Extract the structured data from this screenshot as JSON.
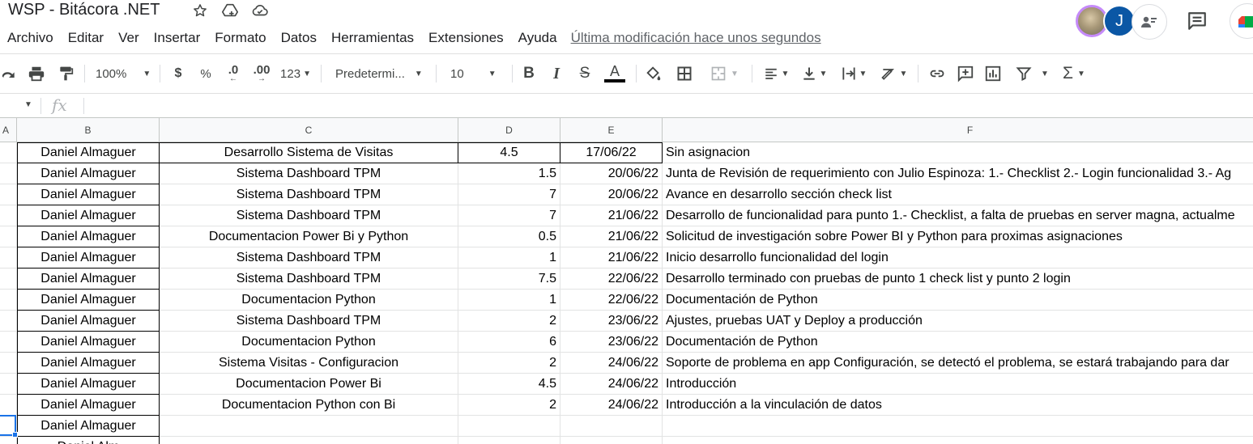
{
  "title": {
    "doc_name": "WSP - Bitácora .NET",
    "star_icon": "star-icon",
    "move_icon": "move-to-drive-icon",
    "cloud_icon": "cloud-saved-icon"
  },
  "menu": {
    "items": [
      "Archivo",
      "Editar",
      "Ver",
      "Insertar",
      "Formato",
      "Datos",
      "Herramientas",
      "Extensiones",
      "Ayuda"
    ],
    "last_modified": "Última modificación hace unos segundos"
  },
  "collaborators": {
    "second_initial": "J"
  },
  "toolbar": {
    "zoom": "100%",
    "currency": "$",
    "percent": "%",
    "decrease_decimals": ".0",
    "increase_decimals": ".00",
    "number_format": "123",
    "font_family": "Predetermi...",
    "font_size": "10"
  },
  "formula_bar": {
    "fx": "fx",
    "value": ""
  },
  "columns": [
    "A",
    "B",
    "C",
    "D",
    "E",
    "F"
  ],
  "rows": [
    {
      "b": "Daniel Almaguer",
      "c": "Desarrollo Sistema de Visitas",
      "d": "4.5",
      "e": "17/06/22",
      "f": "Sin asignacion"
    },
    {
      "b": "Daniel Almaguer",
      "c": "Sistema Dashboard TPM",
      "d": "1.5",
      "e": "20/06/22",
      "f": "Junta de Revisión de requerimiento con Julio Espinoza: 1.- Checklist 2.- Login funcionalidad 3.- Ag"
    },
    {
      "b": "Daniel Almaguer",
      "c": "Sistema Dashboard TPM",
      "d": "7",
      "e": "20/06/22",
      "f": "Avance en desarrollo sección check list"
    },
    {
      "b": "Daniel Almaguer",
      "c": "Sistema Dashboard TPM",
      "d": "7",
      "e": "21/06/22",
      "f": "Desarrollo de funcionalidad para punto 1.- Checklist, a falta de pruebas en server magna, actualme"
    },
    {
      "b": "Daniel Almaguer",
      "c": "Documentacion Power Bi y Python",
      "d": "0.5",
      "e": "21/06/22",
      "f": "Solicitud de investigación sobre Power BI y Python para proximas asignaciones"
    },
    {
      "b": "Daniel Almaguer",
      "c": "Sistema Dashboard TPM",
      "d": "1",
      "e": "21/06/22",
      "f": "Inicio desarrollo funcionalidad del login"
    },
    {
      "b": "Daniel Almaguer",
      "c": "Sistema Dashboard TPM",
      "d": "7.5",
      "e": "22/06/22",
      "f": "Desarrollo terminado con pruebas de punto 1 check list y punto 2 login"
    },
    {
      "b": "Daniel Almaguer",
      "c": "Documentacion Python",
      "d": "1",
      "e": "22/06/22",
      "f": "Documentación de Python"
    },
    {
      "b": "Daniel Almaguer",
      "c": "Sistema Dashboard TPM",
      "d": "2",
      "e": "23/06/22",
      "f": "Ajustes, pruebas UAT y Deploy a producción"
    },
    {
      "b": "Daniel Almaguer",
      "c": "Documentacion Python",
      "d": "6",
      "e": "23/06/22",
      "f": "Documentación de Python"
    },
    {
      "b": "Daniel Almaguer",
      "c": "Sistema Visitas - Configuracion",
      "d": "2",
      "e": "24/06/22",
      "f": "Soporte de problema en app Configuración, se detectó el problema, se estará trabajando para dar"
    },
    {
      "b": "Daniel Almaguer",
      "c": "Documentacion Power Bi",
      "d": "4.5",
      "e": "24/06/22",
      "f": "Introducción"
    },
    {
      "b": "Daniel Almaguer",
      "c": "Documentacion Python con Bi",
      "d": "2",
      "e": "24/06/22",
      "f": "Introducción a la vinculación de datos"
    },
    {
      "b": "Daniel Almaguer",
      "c": "",
      "d": "",
      "e": "",
      "f": ""
    },
    {
      "b": "Daniel Alm",
      "c": "",
      "d": "",
      "e": "",
      "f": ""
    }
  ]
}
